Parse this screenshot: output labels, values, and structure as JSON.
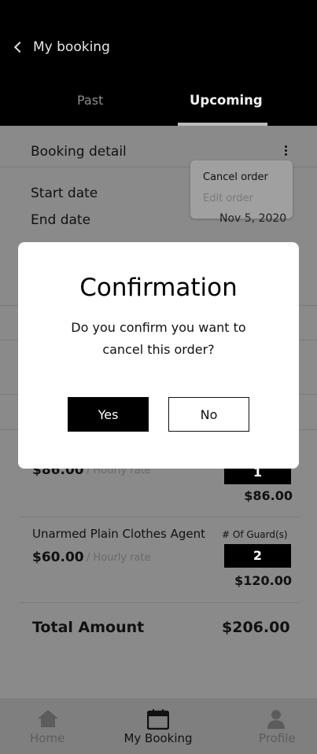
{
  "header": {
    "title": "My booking",
    "tabs": [
      {
        "label": "Past",
        "active": false
      },
      {
        "label": "Upcoming",
        "active": true
      }
    ]
  },
  "booking_detail": {
    "title": "Booking detail",
    "menu": {
      "cancel": "Cancel order",
      "edit": "Edit order"
    },
    "start_label": "Start date",
    "end_label": "End date",
    "end_value": "Nov 5, 2020"
  },
  "services": [
    {
      "name": "",
      "price": "$86.00",
      "rate": "/ Hourly rate",
      "quantity": "1",
      "total": "$86.00"
    },
    {
      "name": "Unarmed Plain Clothes Agent",
      "guard_label": "# Of Guard(s)",
      "price": "$60.00",
      "rate": "/ Hourly rate",
      "quantity": "2",
      "total": "$120.00"
    }
  ],
  "total": {
    "label": "Total Amount",
    "value": "$206.00"
  },
  "modal": {
    "title": "Confirmation",
    "message": "Do you confirm you want to cancel this order?",
    "yes": "Yes",
    "no": "No"
  },
  "nav": {
    "home": "Home",
    "booking": "My Booking",
    "profile": "Profile"
  },
  "colors": {
    "header_bg": "#000000",
    "overlay_bg": "#8a8a8a",
    "accent": "#000000"
  }
}
